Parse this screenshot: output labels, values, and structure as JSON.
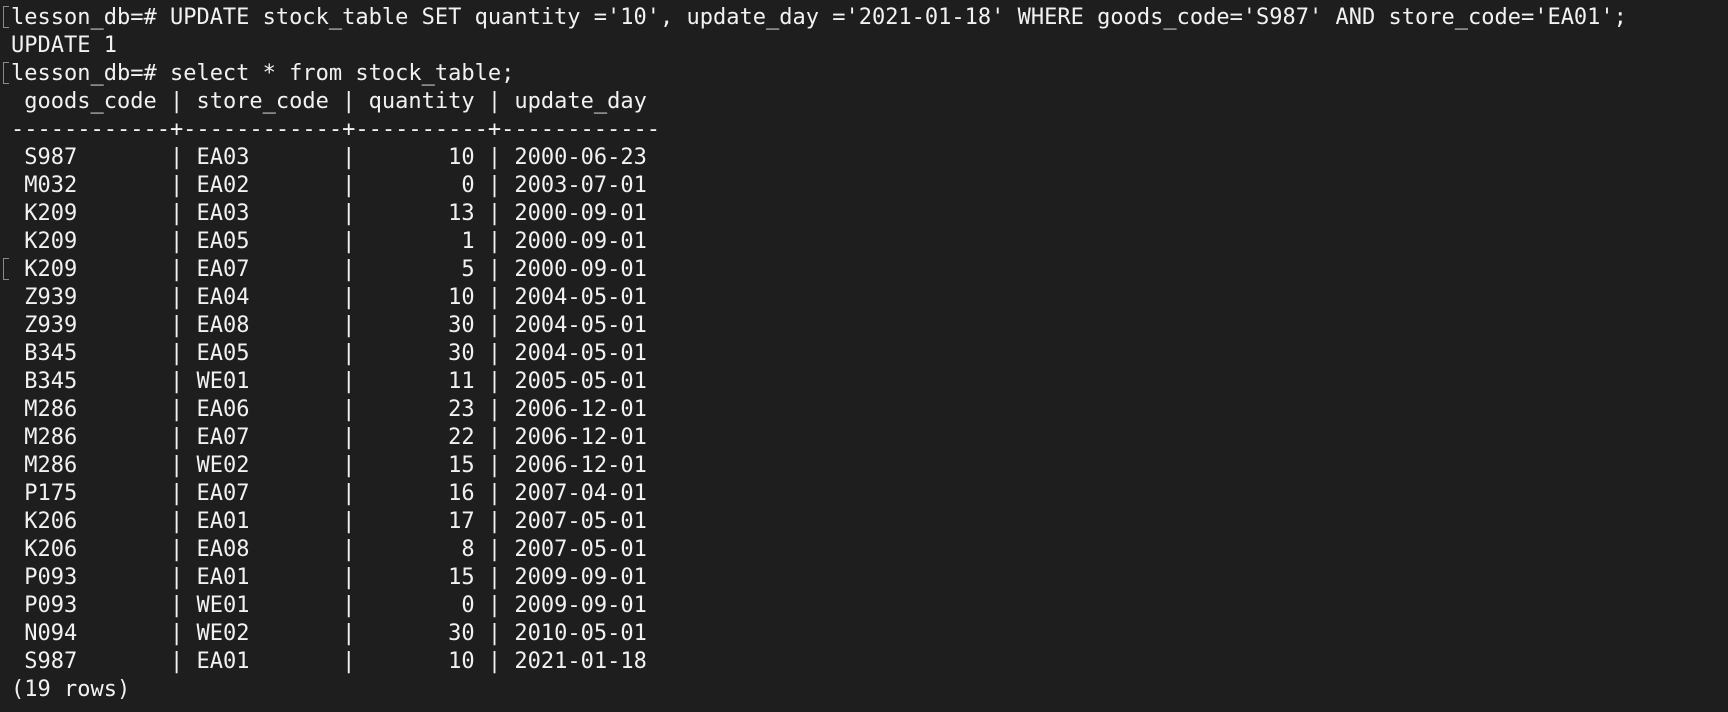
{
  "terminal": {
    "prompt": "lesson_db=# ",
    "update_command": "UPDATE stock_table SET quantity ='10', update_day ='2021-01-18' WHERE goods_code='S987' AND store_code='EA01';",
    "update_result": "UPDATE 1",
    "select_command": "select * from stock_table;",
    "table": {
      "columns": [
        "goods_code",
        "store_code",
        "quantity",
        "update_day"
      ],
      "rows": [
        [
          "S987",
          "EA03",
          "10",
          "2000-06-23"
        ],
        [
          "M032",
          "EA02",
          "0",
          "2003-07-01"
        ],
        [
          "K209",
          "EA03",
          "13",
          "2000-09-01"
        ],
        [
          "K209",
          "EA05",
          "1",
          "2000-09-01"
        ],
        [
          "K209",
          "EA07",
          "5",
          "2000-09-01"
        ],
        [
          "Z939",
          "EA04",
          "10",
          "2004-05-01"
        ],
        [
          "Z939",
          "EA08",
          "30",
          "2004-05-01"
        ],
        [
          "B345",
          "EA05",
          "30",
          "2004-05-01"
        ],
        [
          "B345",
          "WE01",
          "11",
          "2005-05-01"
        ],
        [
          "M286",
          "EA06",
          "23",
          "2006-12-01"
        ],
        [
          "M286",
          "EA07",
          "22",
          "2006-12-01"
        ],
        [
          "M286",
          "WE02",
          "15",
          "2006-12-01"
        ],
        [
          "P175",
          "EA07",
          "16",
          "2007-04-01"
        ],
        [
          "K206",
          "EA01",
          "17",
          "2007-05-01"
        ],
        [
          "K206",
          "EA08",
          "8",
          "2007-05-01"
        ],
        [
          "P093",
          "EA01",
          "15",
          "2009-09-01"
        ],
        [
          "P093",
          "WE01",
          "0",
          "2009-09-01"
        ],
        [
          "N094",
          "WE02",
          "30",
          "2010-05-01"
        ],
        [
          "S987",
          "EA01",
          "10",
          "2021-01-18"
        ]
      ],
      "row_count": "(19 rows)"
    }
  }
}
